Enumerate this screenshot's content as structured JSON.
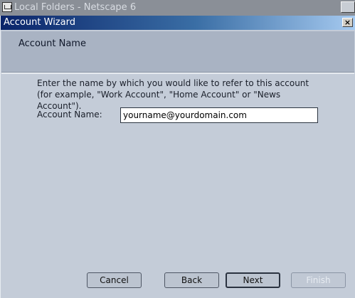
{
  "background_window": {
    "title": "Local Folders - Netscape 6",
    "icon": "mail-icon"
  },
  "dialog": {
    "title": "Account Wizard",
    "close_label": "×"
  },
  "page": {
    "heading": "Account Name",
    "description": "Enter the name by which you would like to refer to this account (for example, \"Work Account\", \"Home Account\" or \"News Account\").",
    "field_label": "Account Name:",
    "field_value": "yourname@yourdomain.com"
  },
  "buttons": {
    "cancel": "Cancel",
    "back": "Back",
    "next": "Next",
    "finish": "Finish"
  },
  "colors": {
    "dialog_title_start": "#0a246a",
    "dialog_title_end": "#a6caf0",
    "header_band": "#a9b3c3",
    "background": "#c4ccd8"
  }
}
